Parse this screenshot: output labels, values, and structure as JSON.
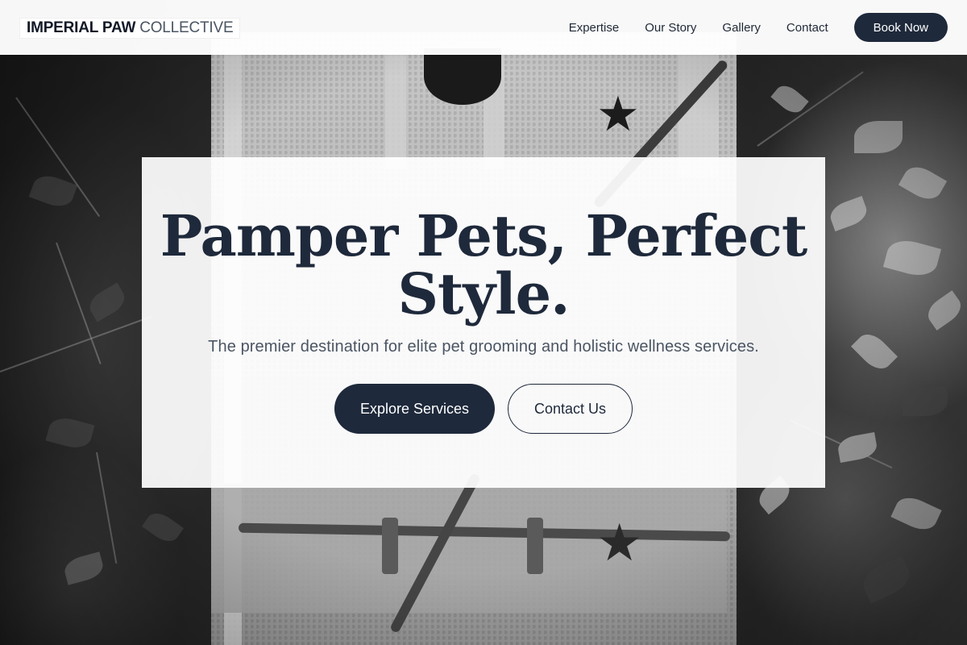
{
  "header": {
    "logo_primary": "IMPERIAL PAW",
    "logo_secondary": "COLLECTIVE",
    "nav": [
      {
        "label": "Expertise"
      },
      {
        "label": "Our Story"
      },
      {
        "label": "Gallery"
      },
      {
        "label": "Contact"
      }
    ],
    "cta_label": "Book Now"
  },
  "hero": {
    "title_line1": "Pamper Pets, Perfect",
    "title_line2": "Style.",
    "subtitle": "The premier destination for elite pet grooming and holistic wellness services.",
    "primary_button": "Explore Services",
    "secondary_button": "Contact Us"
  },
  "colors": {
    "brand_navy": "#1e293b",
    "text_gray": "#4b5563",
    "header_bg": "#ffffff"
  }
}
